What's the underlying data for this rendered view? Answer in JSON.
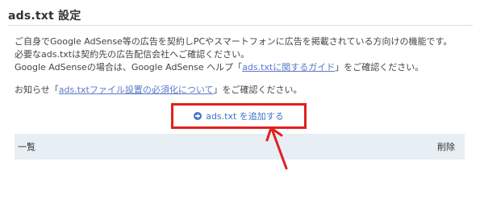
{
  "page": {
    "title": "ads.txt 設定"
  },
  "description": {
    "line1": "ご自身でGoogle AdSense等の広告を契約しPCやスマートフォンに広告を掲載されている方向けの機能です。",
    "line2": "必要なads.txtは契約先の広告配信会社へご確認ください。",
    "line3_prefix": "Google AdSenseの場合は、Google AdSense ヘルプ「",
    "line3_link": "ads.txtに関するガイド",
    "line3_suffix": "」をご確認ください。",
    "notice_prefix": "お知らせ「",
    "notice_link": "ads.txtファイル設置の必須化について",
    "notice_suffix": "」をご確認ください。"
  },
  "add_button": {
    "label": "ads.txt を追加する",
    "icon": "plus-circle-icon"
  },
  "table": {
    "columns": [
      "一覧",
      "削除"
    ]
  },
  "colors": {
    "highlight": "#e0211d",
    "link": "#5a78c9",
    "accent": "#3f77c8",
    "table_header_bg": "#e7eef4"
  }
}
